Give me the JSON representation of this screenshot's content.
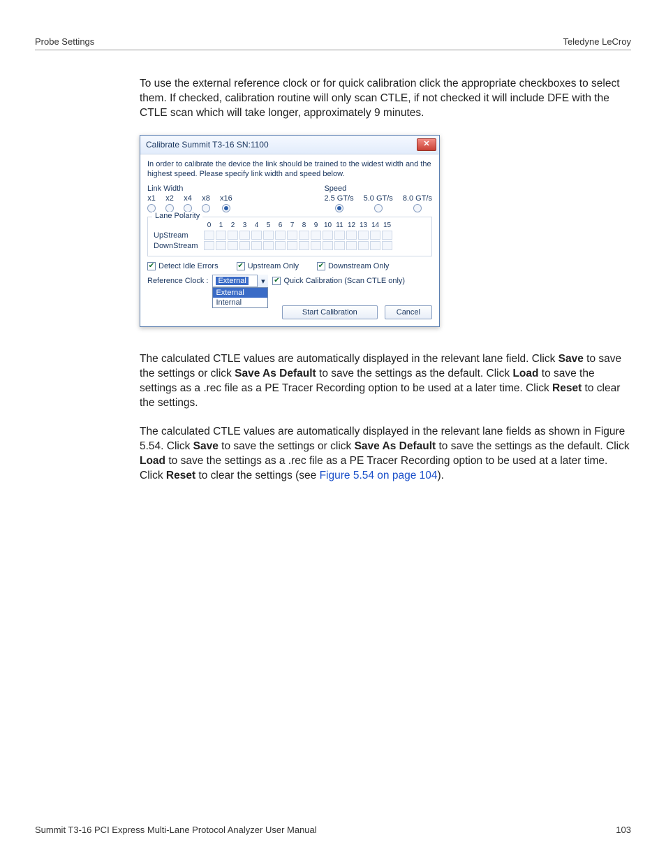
{
  "header": {
    "left": "Probe Settings",
    "right": "Teledyne LeCroy"
  },
  "paragraphs": {
    "p1": "To use the external reference clock or for quick calibration click the appropriate checkboxes to select them. If checked, calibration routine will only scan CTLE, if not checked it will include DFE with the CTLE scan which will take longer, approximately 9 minutes.",
    "p2_a": "The calculated CTLE values are automatically displayed in the relevant lane field. Click ",
    "p2_save": "Save",
    "p2_b": " to save the settings or click ",
    "p2_savedef": "Save As Default",
    "p2_c": " to save the settings as the default. Click ",
    "p2_load": "Load",
    "p2_d": " to save the settings as a .rec file as a PE Tracer Recording option to be used at a later time. Click ",
    "p2_reset": "Reset",
    "p2_e": " to clear the settings.",
    "p3_a": "The calculated CTLE values are automatically displayed in the relevant lane fields as shown in Figure 5.54. Click ",
    "p3_save": "Save",
    "p3_b": " to save the settings or click ",
    "p3_savedef": "Save As Default",
    "p3_c": " to save the settings as the default. Click ",
    "p3_load": "Load",
    "p3_d": " to save the settings as a .rec file as a PE Tracer Recording option to be used at a later time. Click ",
    "p3_reset": "Reset",
    "p3_e": " to clear the settings (see ",
    "p3_link": "Figure 5.54 on page 104",
    "p3_f": ")."
  },
  "dialog": {
    "title": "Calibrate Summit T3-16 SN:1100",
    "instruction": "In order to calibrate the device the link should be trained to the widest width and the highest speed. Please specify link width and speed below.",
    "linkwidth": {
      "label": "Link Width",
      "options": [
        "x1",
        "x2",
        "x4",
        "x8",
        "x16"
      ],
      "selected": "x16"
    },
    "speed": {
      "label": "Speed",
      "options": [
        "2.5 GT/s",
        "5.0 GT/s",
        "8.0 GT/s"
      ],
      "selected": "2.5 GT/s"
    },
    "lanepolarity": {
      "legend": "Lane Polarity",
      "headers": [
        "0",
        "1",
        "2",
        "3",
        "4",
        "5",
        "6",
        "7",
        "8",
        "9",
        "10",
        "11",
        "12",
        "13",
        "14",
        "15"
      ],
      "rows": [
        "UpStream",
        "DownStream"
      ]
    },
    "checks": {
      "detect_idle": "Detect Idle Errors",
      "upstream_only": "Upstream Only",
      "downstream_only": "Downstream Only",
      "quick_cal": "Quick Calibration (Scan CTLE only)"
    },
    "refclock": {
      "label": "Reference Clock :",
      "selected": "External",
      "options": [
        "External",
        "Internal"
      ]
    },
    "buttons": {
      "start": "Start Calibration",
      "cancel": "Cancel"
    }
  },
  "footer": {
    "left": "Summit T3-16 PCI Express Multi-Lane Protocol Analyzer User Manual",
    "right": "103"
  }
}
